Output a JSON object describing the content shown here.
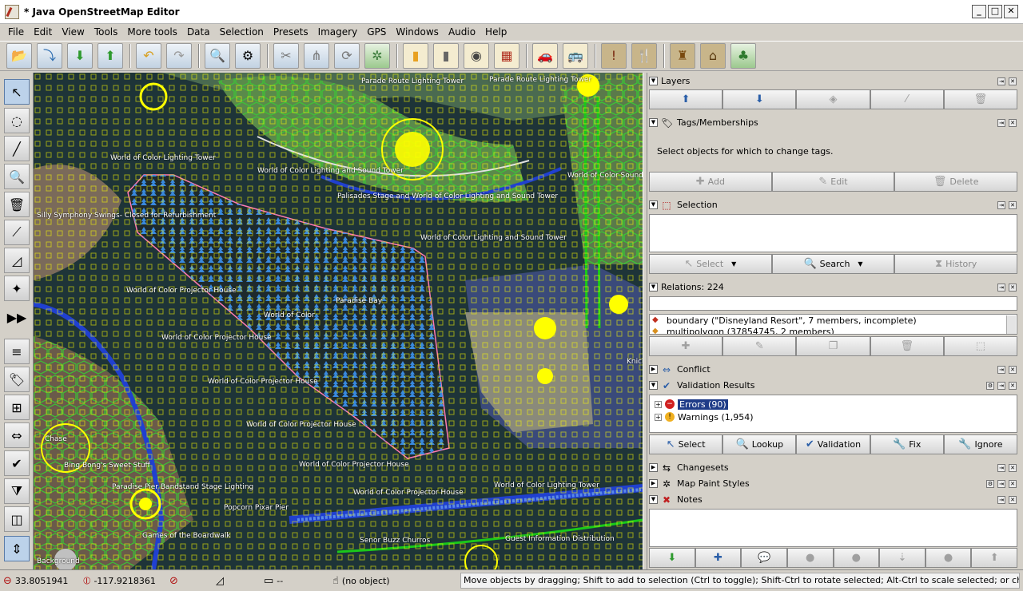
{
  "window": {
    "title": "* Java OpenStreetMap Editor"
  },
  "menubar": [
    "File",
    "Edit",
    "View",
    "Tools",
    "More tools",
    "Data",
    "Selection",
    "Presets",
    "Imagery",
    "GPS",
    "Windows",
    "Audio",
    "Help"
  ],
  "toolbar": {
    "groups": [
      [
        "open-file-icon",
        "open-location-icon",
        "download-icon",
        "upload-icon"
      ],
      [
        "undo-icon",
        "redo-icon"
      ],
      [
        "zoom-selection-icon",
        "preferences-icon"
      ],
      [
        "split-way-icon",
        "combine-way-icon",
        "refresh-icon",
        "simplify-icon"
      ],
      [
        "highway-icon",
        "road-icon",
        "traffic-signal-icon",
        "wall-icon"
      ],
      [
        "car-icon",
        "bus-icon"
      ],
      [
        "alert-icon",
        "restaurant-icon"
      ],
      [
        "castle-icon",
        "factory-icon",
        "tree-icon"
      ]
    ]
  },
  "left_tools": [
    "select-mode-icon",
    "lasso-icon",
    "draw-icon",
    "zoom-icon",
    "delete-icon",
    "parallel-icon",
    "measure-icon",
    "improve-way-icon",
    "more-arrow-icon",
    "layers-toggle-icon",
    "tag-toggle-icon",
    "relation-toggle-icon",
    "conflict-toggle-icon",
    "validator-toggle-icon",
    "filter-toggle-icon",
    "minimap-toggle-icon",
    "fullscreen-icon"
  ],
  "map": {
    "labels": [
      "Parade Route Lighting Tower",
      "Parade Route Lighting Tower",
      "World of Color Lighting Tower",
      "World of Color Lighting and Sound Tower",
      "Silly Symphony Swings- Closed for Refurbishment",
      "Palisades Stage and World of Color Lighting and Sound Tower",
      "World of Color Lighting and Sound Tower",
      "World of Color Sound To",
      "World of Color Projector House",
      "Paradise Bay",
      "World of Color",
      "World of Color Projector House",
      "World of Color Projector House",
      "World of Color Projector House",
      "Chase",
      "Bing Bong's Sweet Stuff",
      "World of Color Projector House",
      "Paradise Pier Bandstand Stage Lighting",
      "World of Color Projector House",
      "World of Color Lighting Tower",
      "Popcorn Pixar Pier",
      "Games of the Boardwalk",
      "Senor Buzz Churros",
      "Guest Information Distribution",
      "Background",
      "Knick"
    ]
  },
  "panels": {
    "layers": {
      "title": "Layers"
    },
    "tags": {
      "title": "Tags/Memberships",
      "hint": "Select objects for which to change tags.",
      "buttons": [
        "Add",
        "Edit",
        "Delete"
      ]
    },
    "selection": {
      "title": "Selection",
      "buttons": [
        "Select",
        "Search",
        "History"
      ]
    },
    "relations": {
      "title": "Relations: 224",
      "items": [
        "boundary (\"Disneyland Resort\", 7 members, incomplete)",
        "multipolygon (37854745, 2 members)"
      ]
    },
    "conflict": {
      "title": "Conflict"
    },
    "validation": {
      "title": "Validation Results",
      "items": [
        "Errors (90)",
        "Warnings (1,954)"
      ],
      "buttons": [
        "Select",
        "Lookup",
        "Validation",
        "Fix",
        "Ignore"
      ]
    },
    "changesets": {
      "title": "Changesets"
    },
    "mappaint": {
      "title": "Map Paint Styles"
    },
    "notes": {
      "title": "Notes"
    }
  },
  "statusbar": {
    "lat": "33.8051941",
    "lon": "-117.9218361",
    "heading": "--",
    "object": "(no object)",
    "message": "Move objects by dragging; Shift to add to selection (Ctrl to toggle); Shift-Ctrl to rotate selected; Alt-Ctrl to scale selected; or change selection"
  },
  "colors": {
    "highlight": "#1f3c88",
    "water_area": "#3a8ee6",
    "node_yellow": "#ffff00",
    "way_green": "#2ee02e"
  }
}
